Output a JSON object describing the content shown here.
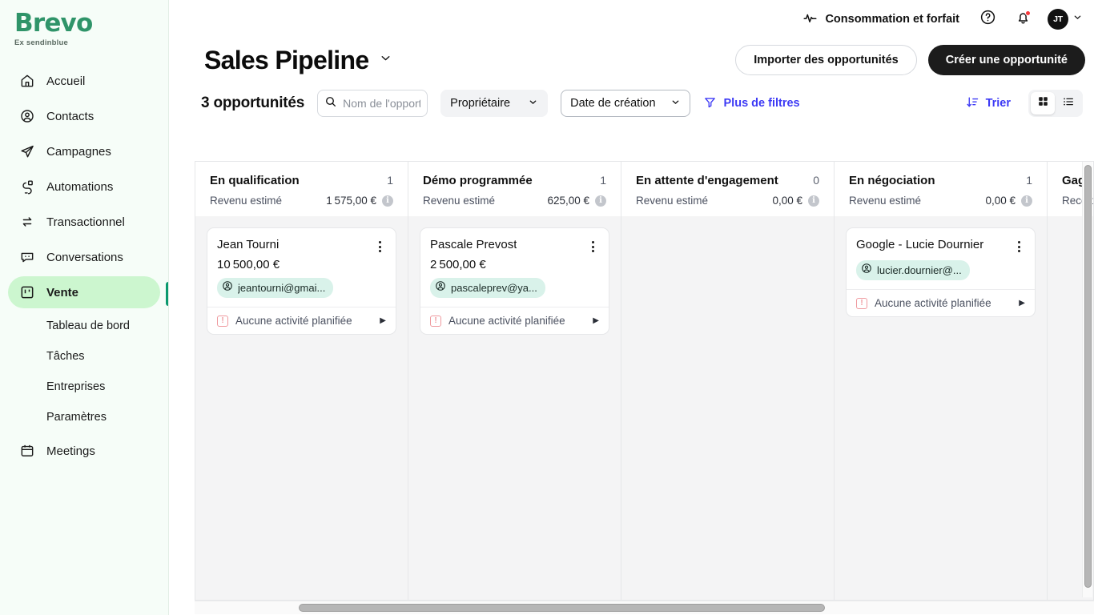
{
  "brand": {
    "name": "Brevo",
    "tagline": "Ex sendinblue"
  },
  "sidebar": {
    "items": [
      {
        "label": "Accueil",
        "icon": "home-icon"
      },
      {
        "label": "Contacts",
        "icon": "user-circle-icon"
      },
      {
        "label": "Campagnes",
        "icon": "paper-plane-icon"
      },
      {
        "label": "Automations",
        "icon": "automation-icon"
      },
      {
        "label": "Transactionnel",
        "icon": "exchange-icon"
      },
      {
        "label": "Conversations",
        "icon": "chat-bubble-icon"
      },
      {
        "label": "Vente",
        "icon": "board-icon",
        "active": true
      },
      {
        "label": "Meetings",
        "icon": "calendar-icon"
      }
    ],
    "sub_items": [
      {
        "label": "Tableau de bord"
      },
      {
        "label": "Tâches"
      },
      {
        "label": "Entreprises"
      },
      {
        "label": "Paramètres"
      }
    ]
  },
  "topbar": {
    "usage_label": "Consommation et forfait",
    "usage_icon": "pulse-icon",
    "help_icon": "help-circle-icon",
    "notifications_icon": "bell-icon",
    "avatar_initials": "JT",
    "chevron_icon": "chevron-down-icon"
  },
  "header": {
    "title": "Sales Pipeline",
    "title_chevron_icon": "chevron-down-icon",
    "import_button": "Importer des opportunités",
    "create_button": "Créer une opportunité"
  },
  "toolbar": {
    "count_label": "3 opportunités",
    "search": {
      "placeholder": "Nom de l'opportunité",
      "value": "",
      "icon": "search-icon"
    },
    "filters": [
      {
        "label": "Propriétaire",
        "outlined": false
      },
      {
        "label": "Date de création",
        "outlined": true
      }
    ],
    "more_filters": {
      "label": "Plus de filtres",
      "icon": "funnel-icon"
    },
    "sort": {
      "label": "Trier",
      "icon": "sort-icon"
    },
    "view_grid_icon": "grid-view-icon",
    "view_list_icon": "list-view-icon",
    "selected_view": "grid"
  },
  "accent_colors": {
    "brand_green": "#2f9469",
    "active_pill": "#ccf6cf",
    "active_bar": "#0b996e",
    "link_blue": "#3d3af5",
    "primary_button": "#1c1c1c",
    "contact_chip": "#d9f2ea",
    "warning_pink": "#ef9a9f"
  },
  "board": {
    "revenue_label": "Revenu estimé",
    "no_activity_label": "Aucune activité planifiée",
    "columns": [
      {
        "name": "En qualification",
        "count": "1",
        "revenue_label": "Revenu estimé",
        "revenue": "1 575,00 €",
        "cards": [
          {
            "title": "Jean Tourni",
            "amount": "10 500,00 €",
            "contact": "jeantourni@gmai...",
            "activity": "Aucune activité planifiée"
          }
        ]
      },
      {
        "name": "Démo programmée",
        "count": "1",
        "revenue_label": "Revenu estimé",
        "revenue": "625,00 €",
        "cards": [
          {
            "title": "Pascale Prevost",
            "amount": "2 500,00 €",
            "contact": "pascaleprev@ya...",
            "activity": "Aucune activité planifiée"
          }
        ]
      },
      {
        "name": "En attente d'engagement",
        "count": "0",
        "revenue_label": "Revenu estimé",
        "revenue": "0,00 €",
        "cards": []
      },
      {
        "name": "En négociation",
        "count": "1",
        "revenue_label": "Revenu estimé",
        "revenue": "0,00 €",
        "cards": [
          {
            "title": "Google - Lucie Dournier",
            "amount": "",
            "contact": "lucier.dournier@...",
            "activity": "Aucune activité planifiée"
          }
        ]
      },
      {
        "name": "Gagné",
        "count": "",
        "revenue_label": "Recette",
        "revenue": "",
        "cards": []
      }
    ]
  }
}
